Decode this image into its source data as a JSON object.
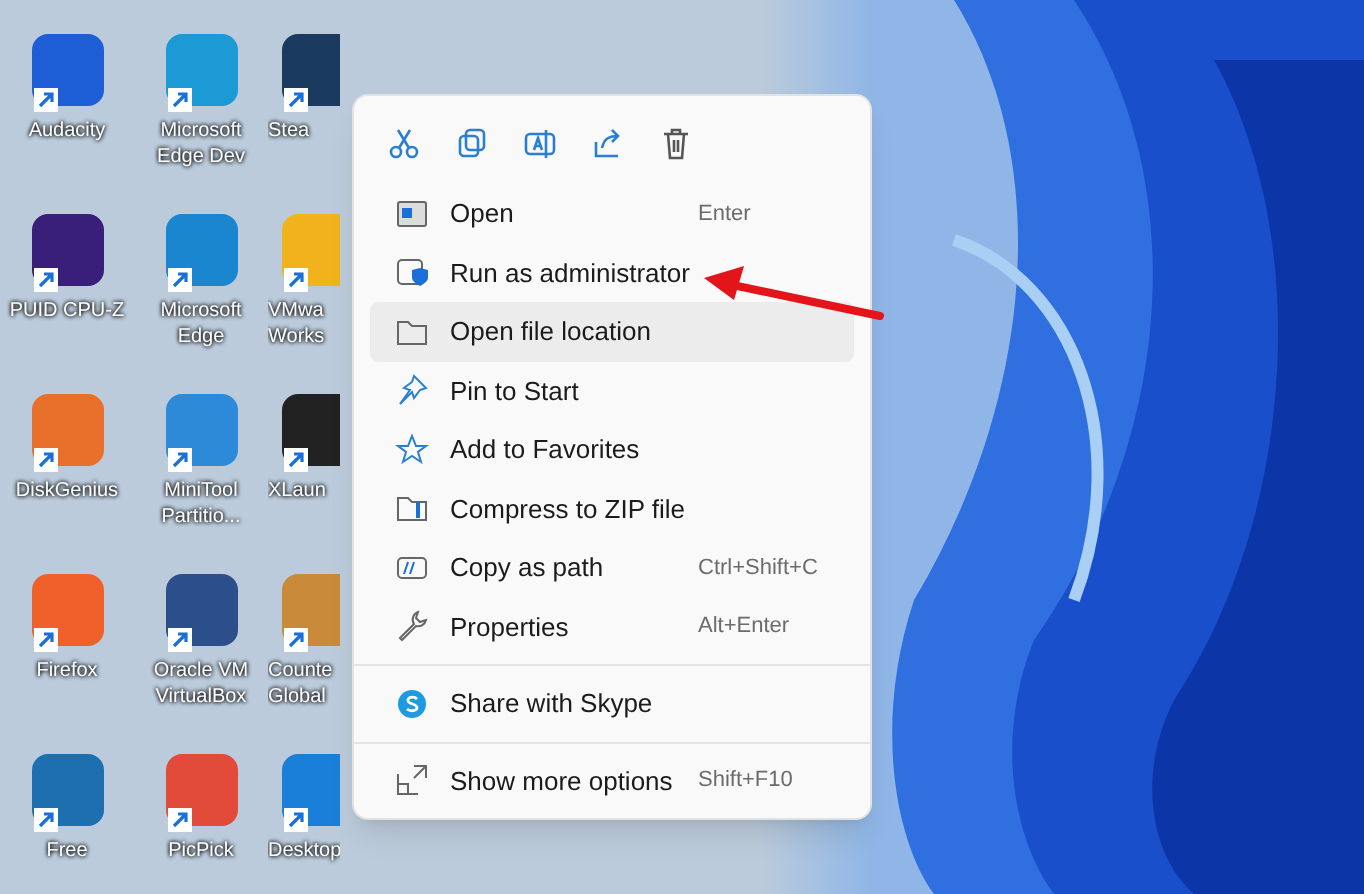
{
  "desktop_icons": [
    {
      "label": [
        "Audacity"
      ],
      "color": "#1e5fd8"
    },
    {
      "label": [
        "Microsoft",
        "Edge Dev"
      ],
      "color": "#1c9ad6"
    },
    {
      "label": [
        "Stea"
      ],
      "color": "#1b3a60"
    },
    {
      "label": [
        "PUID CPU-Z"
      ],
      "color": "#3a1f7a"
    },
    {
      "label": [
        "Microsoft",
        "Edge"
      ],
      "color": "#1a86d0"
    },
    {
      "label": [
        "VMwa",
        "Works"
      ],
      "color": "#f2b21c"
    },
    {
      "label": [
        "DiskGenius"
      ],
      "color": "#e8702a"
    },
    {
      "label": [
        "MiniTool",
        "Partitio..."
      ],
      "color": "#2d8ad8"
    },
    {
      "label": [
        "XLaun"
      ],
      "color": "#222222"
    },
    {
      "label": [
        "Firefox"
      ],
      "color": "#f0602a"
    },
    {
      "label": [
        "Oracle VM",
        "VirtualBox"
      ],
      "color": "#2b4f8a"
    },
    {
      "label": [
        "Counte",
        "Global"
      ],
      "color": "#c98a3a"
    },
    {
      "label": [
        "Free"
      ],
      "color": "#1d6fb0"
    },
    {
      "label": [
        "PicPick"
      ],
      "color": "#e24b3a"
    },
    {
      "label": [
        "Desktop"
      ],
      "color": "#1a7fd8"
    }
  ],
  "context_menu": {
    "sections": [
      [
        {
          "label": "Open",
          "shortcut": "Enter",
          "selected": false
        },
        {
          "label": "Run as administrator",
          "selected": false
        },
        {
          "label": "Open file location",
          "selected": true
        },
        {
          "label": "Pin to Start",
          "selected": false
        },
        {
          "label": "Add to Favorites",
          "selected": false
        },
        {
          "label": "Compress to ZIP file",
          "selected": false
        },
        {
          "label": "Copy as path",
          "shortcut": "Ctrl+Shift+C",
          "selected": false
        },
        {
          "label": "Properties",
          "shortcut": "Alt+Enter",
          "selected": false
        }
      ],
      [
        {
          "label": "Share with Skype",
          "selected": false
        }
      ],
      [
        {
          "label": "Show more options",
          "shortcut": "Shift+F10",
          "selected": false
        }
      ]
    ]
  }
}
